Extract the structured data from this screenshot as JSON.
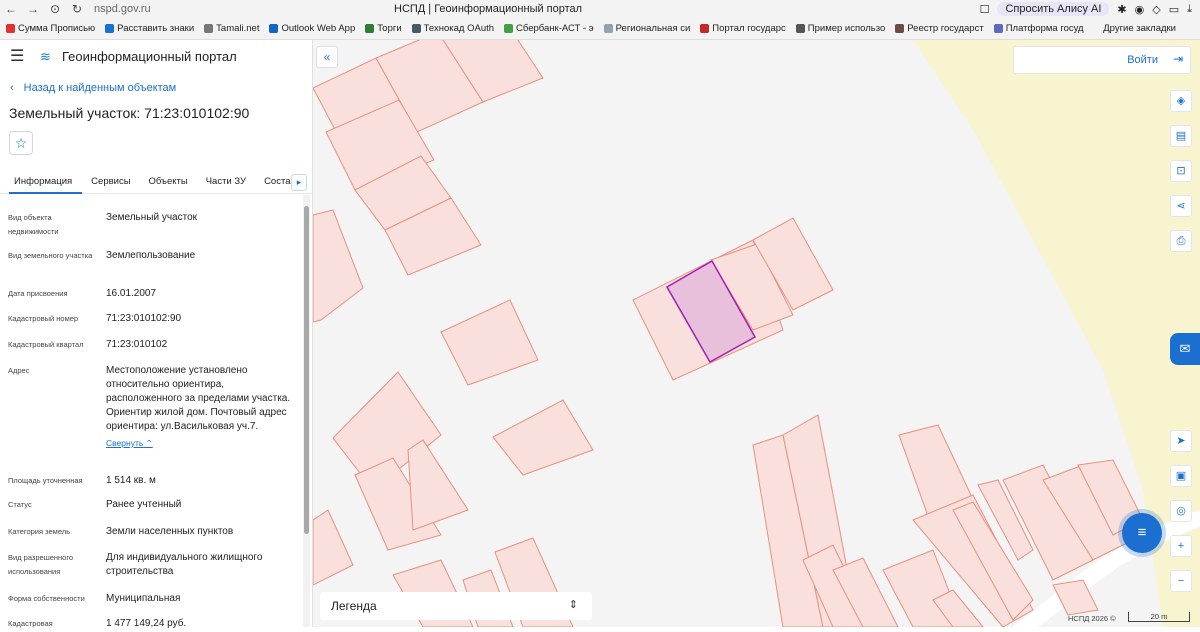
{
  "browser": {
    "url": "nspd.gov.ru",
    "title": "НСПД | Геоинформационный портал",
    "alice": "Спросить Алису AI",
    "bookmarks": [
      "Сумма Прописью",
      "Расставить знаки",
      "Tamali.net",
      "Outlook Web App",
      "Торги",
      "Технокад OAuth",
      "Сбербанк-АСТ - э",
      "Региональная си",
      "Портал государс",
      "Пример использо",
      "Реестр государст",
      "Платформа госуд"
    ],
    "other_bookmarks": "Другие закладки"
  },
  "panel": {
    "title": "Геоинформационный портал",
    "back": "Назад к найденным объектам",
    "plot_title": "Земельный участок: 71:23:010102:90",
    "tabs": [
      "Информация",
      "Сервисы",
      "Объекты",
      "Части ЗУ",
      "Состав"
    ],
    "props": [
      {
        "label": "Вид объекта недвижимости",
        "value": "Земельный участок"
      },
      {
        "label": "Вид земельного участка",
        "value": "Землепользование"
      },
      {
        "label": "Дата присвоения",
        "value": "16.01.2007"
      },
      {
        "label": "Кадастровый номер",
        "value": "71:23:010102:90"
      },
      {
        "label": "Кадастровый квартал",
        "value": "71:23:010102"
      },
      {
        "label": "Адрес",
        "value": "Местоположение установлено относительно ориентира, расположенного за пределами участка. Ориентир жилой дом. Почтовый адрес ориентира: ул.Васильковая уч.7."
      },
      {
        "label": "Площадь уточненная",
        "value": "1 514 кв. м"
      },
      {
        "label": "Статус",
        "value": "Ранее учтенный"
      },
      {
        "label": "Категория земель",
        "value": "Земли населенных пунктов"
      },
      {
        "label": "Вид разрешенного использования",
        "value": "Для индивидуального жилищного строительства"
      },
      {
        "label": "Форма собственности",
        "value": "Муниципальная"
      },
      {
        "label": "Кадастровая",
        "value": "1 477 149,24 руб."
      }
    ],
    "collapse": "Свернуть"
  },
  "map": {
    "login": "Войти",
    "legend": "Легенда",
    "copyright": "НСПД 2026 ©",
    "scale": "20 m"
  }
}
